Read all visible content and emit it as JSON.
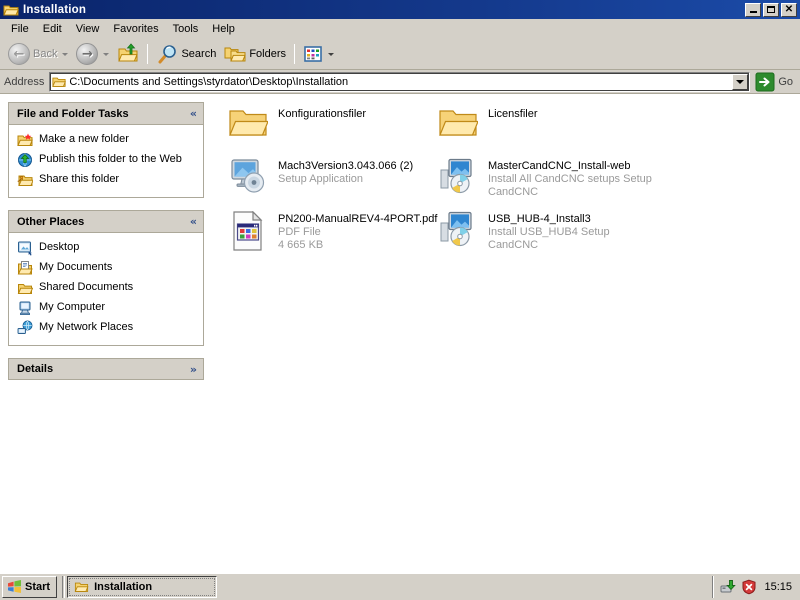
{
  "window": {
    "title": "Installation",
    "title_icon": "open-folder-icon",
    "buttons": {
      "minimize": "Minimize",
      "maximize": "Restore",
      "close": "Close"
    }
  },
  "menubar": {
    "items": [
      {
        "label": "File"
      },
      {
        "label": "Edit"
      },
      {
        "label": "View"
      },
      {
        "label": "Favorites"
      },
      {
        "label": "Tools"
      },
      {
        "label": "Help"
      }
    ]
  },
  "toolbar": {
    "back": {
      "label": "Back",
      "icon": "back-arrow-icon",
      "disabled": true
    },
    "forward": {
      "label": "",
      "icon": "forward-arrow-icon",
      "disabled": false
    },
    "up": {
      "label": "",
      "icon": "up-folder-icon"
    },
    "search": {
      "label": "Search",
      "icon": "search-magnifier-icon"
    },
    "folders": {
      "label": "Folders",
      "icon": "folders-icon"
    },
    "views": {
      "label": "",
      "icon": "views-icon"
    }
  },
  "address": {
    "label": "Address",
    "icon": "folder-icon",
    "path": "C:\\Documents and Settings\\styrdator\\Desktop\\Installation",
    "dropdown_icon": "chevron-down-icon",
    "go": {
      "label": "Go",
      "icon": "go-arrow-icon"
    }
  },
  "sidebar": {
    "panels": [
      {
        "title": "File and Folder Tasks",
        "collapsed": false,
        "chevron": "«",
        "items": [
          {
            "label": "Make a new folder",
            "icon": "new-folder-icon"
          },
          {
            "label": "Publish this folder to the Web",
            "icon": "publish-web-icon"
          },
          {
            "label": "Share this folder",
            "icon": "share-folder-icon"
          }
        ]
      },
      {
        "title": "Other Places",
        "collapsed": false,
        "chevron": "«",
        "items": [
          {
            "label": "Desktop",
            "icon": "desktop-icon"
          },
          {
            "label": "My Documents",
            "icon": "my-documents-icon"
          },
          {
            "label": "Shared Documents",
            "icon": "shared-documents-icon"
          },
          {
            "label": "My Computer",
            "icon": "my-computer-icon"
          },
          {
            "label": "My Network Places",
            "icon": "my-network-places-icon"
          }
        ]
      },
      {
        "title": "Details",
        "collapsed": true,
        "chevron": "»",
        "items": []
      }
    ]
  },
  "files": [
    {
      "name": "Konfigurationsfiler",
      "type_label": "",
      "size_label": "",
      "icon": "folder-icon"
    },
    {
      "name": "Licensfiler",
      "type_label": "",
      "size_label": "",
      "icon": "folder-icon"
    },
    {
      "name": "Mach3Version3.043.066 (2)",
      "type_label": "Setup Application",
      "size_label": "",
      "icon": "setup-monitor-cd-icon"
    },
    {
      "name": "MasterCandCNC_Install-web",
      "type_label": "Install All CandCNC setups Setup",
      "size_label": "CandCNC",
      "icon": "installer-monitor-cd-icon"
    },
    {
      "name": "PN200-ManualREV4-4PORT.pdf",
      "type_label": "PDF File",
      "size_label": "4 665 KB",
      "icon": "pdf-document-icon"
    },
    {
      "name": "USB_HUB-4_Install3",
      "type_label": "Install USB_HUB4 Setup",
      "size_label": "CandCNC",
      "icon": "installer-monitor-cd-icon"
    }
  ],
  "taskbar": {
    "start": {
      "label": "Start",
      "icon": "windows-flag-icon"
    },
    "tasks": [
      {
        "label": "Installation",
        "icon": "folder-icon",
        "active": true
      }
    ],
    "tray": {
      "icons": [
        {
          "name": "safely-remove-hardware-icon"
        },
        {
          "name": "security-alert-shield-icon"
        }
      ],
      "clock": "15:15"
    }
  },
  "colors": {
    "title_bar": "#0a246a",
    "chrome": "#d4d0c8",
    "panel_header": "#d4d0c8",
    "content_bg": "#ffffff",
    "subtext": "#9a9a9a",
    "go_green": "#2e8b2e"
  }
}
